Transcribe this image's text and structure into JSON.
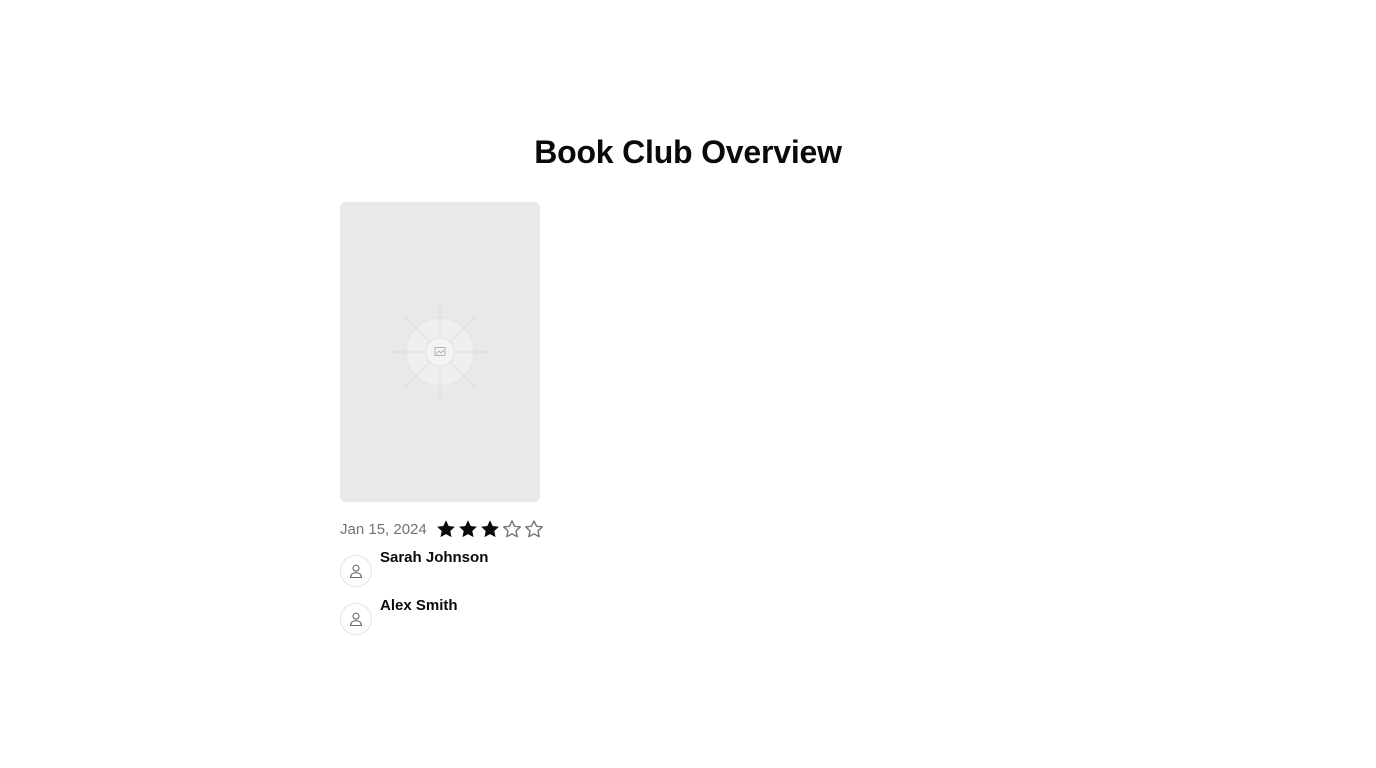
{
  "page": {
    "title": "Book Club Overview"
  },
  "book": {
    "cover_icon": "image-placeholder-icon",
    "date": "Jan 15, 2024",
    "rating": 3,
    "rating_max": 5,
    "star_color": "#0a0a0a",
    "star_outline_color": "#737373"
  },
  "members": [
    {
      "name": "Sarah Johnson",
      "icon": "user-icon"
    },
    {
      "name": "Alex Smith",
      "icon": "user-icon"
    }
  ]
}
